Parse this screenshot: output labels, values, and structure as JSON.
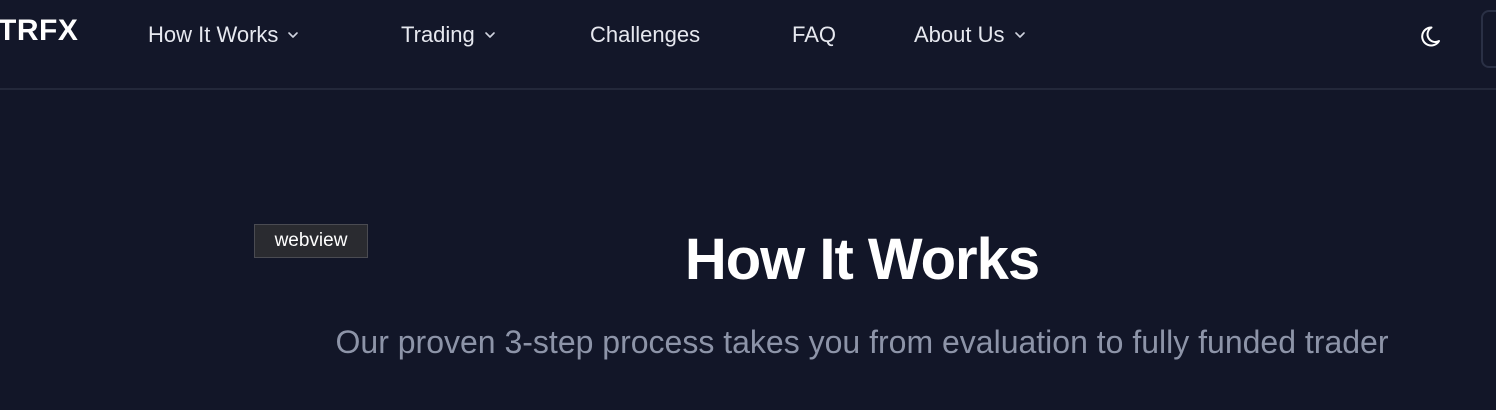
{
  "nav": {
    "logo": "TRFX",
    "items": [
      {
        "label": "How It Works",
        "has_dropdown": true
      },
      {
        "label": "Trading",
        "has_dropdown": true
      },
      {
        "label": "Challenges",
        "has_dropdown": false
      },
      {
        "label": "FAQ",
        "has_dropdown": false
      },
      {
        "label": "About Us",
        "has_dropdown": true
      }
    ],
    "theme_icon": "moon-icon"
  },
  "tooltip": {
    "text": "webview"
  },
  "hero": {
    "title": "How It Works",
    "subtitle": "Our proven 3-step process takes you from evaluation to fully funded trader"
  },
  "colors": {
    "background": "#121628",
    "nav_text": "#e6e8ef",
    "title": "#ffffff",
    "subtitle": "#8d94a8"
  }
}
